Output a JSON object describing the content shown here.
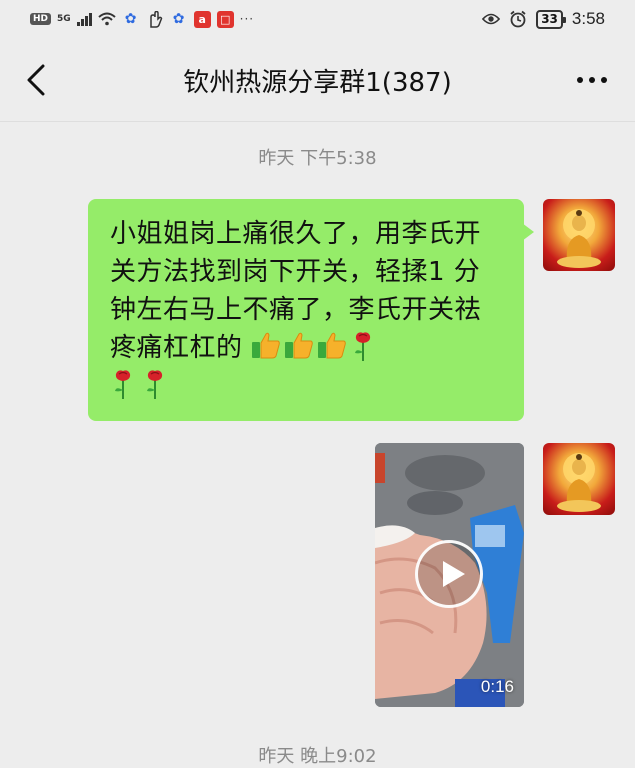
{
  "status_bar": {
    "hd": "HD",
    "network": "5G",
    "red_app_letter": "a",
    "dots": "···",
    "battery": "33",
    "time": "3:58"
  },
  "header": {
    "title": "钦州热源分享群1(387)"
  },
  "messages": [
    {
      "timestamp": "昨天 下午5:38",
      "text": "小姐姐岗上痛很久了，用李氏开关方法找到岗下开关，轻揉1 分钟左右马上不痛了，李氏开关祛疼痛杠杠的"
    },
    {
      "video_duration": "0:16"
    },
    {
      "timestamp": "昨天 晚上9:02"
    }
  ],
  "colors": {
    "background": "#ededed",
    "bubble": "#95ec69",
    "timestamp": "#8a8a8a"
  },
  "icons": [
    "back-arrow-icon",
    "more-icon",
    "play-icon",
    "thumbs-up-emoji",
    "rose-emoji",
    "buddha-avatar"
  ]
}
